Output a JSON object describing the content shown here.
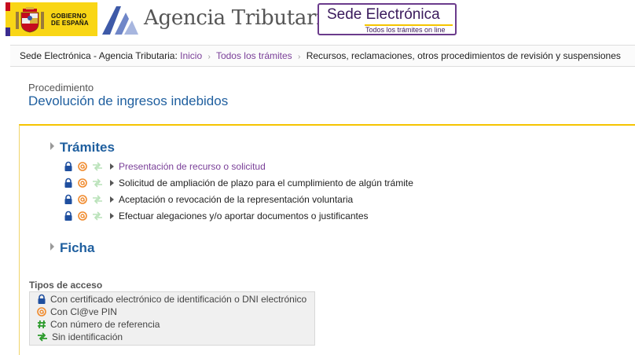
{
  "header": {
    "gobierno_line1": "GOBIERNO",
    "gobierno_line2": "DE ESPAÑA",
    "agency_name": "Agencia Tributaria",
    "sede_title_a": "Sede ",
    "sede_title_b": "Electrónica",
    "sede_subtitle": "Todos los trámites on line"
  },
  "breadcrumb": {
    "site": "Sede Electrónica - Agencia Tributaria:",
    "items": [
      "Inicio",
      "Todos los trámites"
    ],
    "current": "Recursos, reclamaciones, otros procedimientos de revisión y suspensiones"
  },
  "procedure": {
    "label": "Procedimiento",
    "title": "Devolución de ingresos indebidos"
  },
  "sections": {
    "tramites": "Trámites",
    "ficha": "Ficha"
  },
  "tramites": [
    {
      "label": "Presentación de recurso o solicitud",
      "visited": true
    },
    {
      "label": "Solicitud de ampliación de plazo para el cumplimiento de algún trámite",
      "visited": false
    },
    {
      "label": "Aceptación o revocación de la representación voluntaria",
      "visited": false
    },
    {
      "label": "Efectuar alegaciones y/o aportar documentos o justificantes",
      "visited": false
    }
  ],
  "access": {
    "title": "Tipos de acceso",
    "items": [
      {
        "icon": "lock-icon",
        "label": "Con certificado electrónico de identificación o DNI electrónico"
      },
      {
        "icon": "clave-pin-icon",
        "label": "Con Cl@ve PIN"
      },
      {
        "icon": "hash-icon",
        "label": "Con número de referencia"
      },
      {
        "icon": "arrows-icon",
        "label": "Sin identificación"
      }
    ]
  },
  "colors": {
    "link": "#7a3f98",
    "title_blue": "#1f5f9f",
    "lock": "#1f4f9f",
    "clave": "#f08a2c",
    "hash": "#2a9a2a",
    "arrows": "#3aaa3a",
    "accent_yellow": "#f5c400"
  }
}
